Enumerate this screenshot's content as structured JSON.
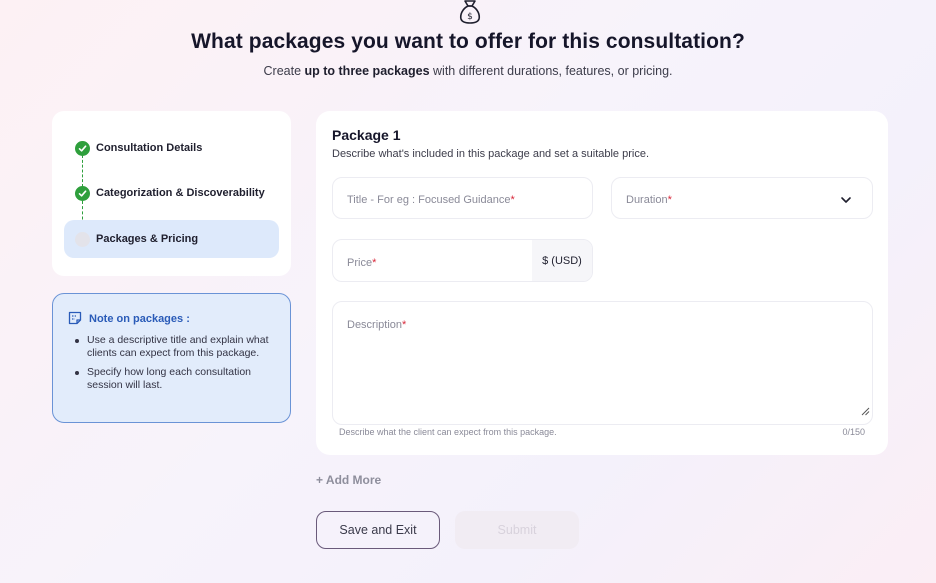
{
  "header": {
    "icon": "money-bag-icon",
    "title": "What packages you want to offer for this consultation?",
    "subtitle_prefix": "Create ",
    "subtitle_bold": "up to three packages",
    "subtitle_suffix": " with different durations, features, or pricing."
  },
  "stepper": {
    "steps": [
      {
        "label": "Consultation Details",
        "status": "done"
      },
      {
        "label": "Categorization & Discoverability",
        "status": "done"
      },
      {
        "label": "Packages & Pricing",
        "status": "current"
      }
    ]
  },
  "note": {
    "icon": "note-icon",
    "title": "Note on packages :",
    "items": [
      "Use a descriptive title and explain what clients can expect from this package.",
      "Specify how long each consultation session will last."
    ]
  },
  "package": {
    "title": "Package 1",
    "description": "Describe what's included in this package and set a suitable price.",
    "title_field": {
      "placeholder": "Title - For eg : Focused Guidance",
      "required_mark": "*"
    },
    "duration_field": {
      "placeholder": "Duration",
      "required_mark": "*",
      "icon": "chevron-down-icon"
    },
    "price_field": {
      "placeholder": "Price",
      "required_mark": "*",
      "currency": "$ (USD)"
    },
    "description_field": {
      "placeholder": "Description",
      "required_mark": "*"
    },
    "helper_text": "Describe what the client can expect from this package.",
    "char_counter": "0/150"
  },
  "actions": {
    "add_more": "+ Add More",
    "save_exit": "Save and Exit",
    "submit": "Submit"
  },
  "colors": {
    "success": "#2e9f3c",
    "active_step_bg": "#dde9fb",
    "note_bg": "#e2ecfb",
    "note_border": "#6a93d6",
    "required": "#d8283a"
  }
}
